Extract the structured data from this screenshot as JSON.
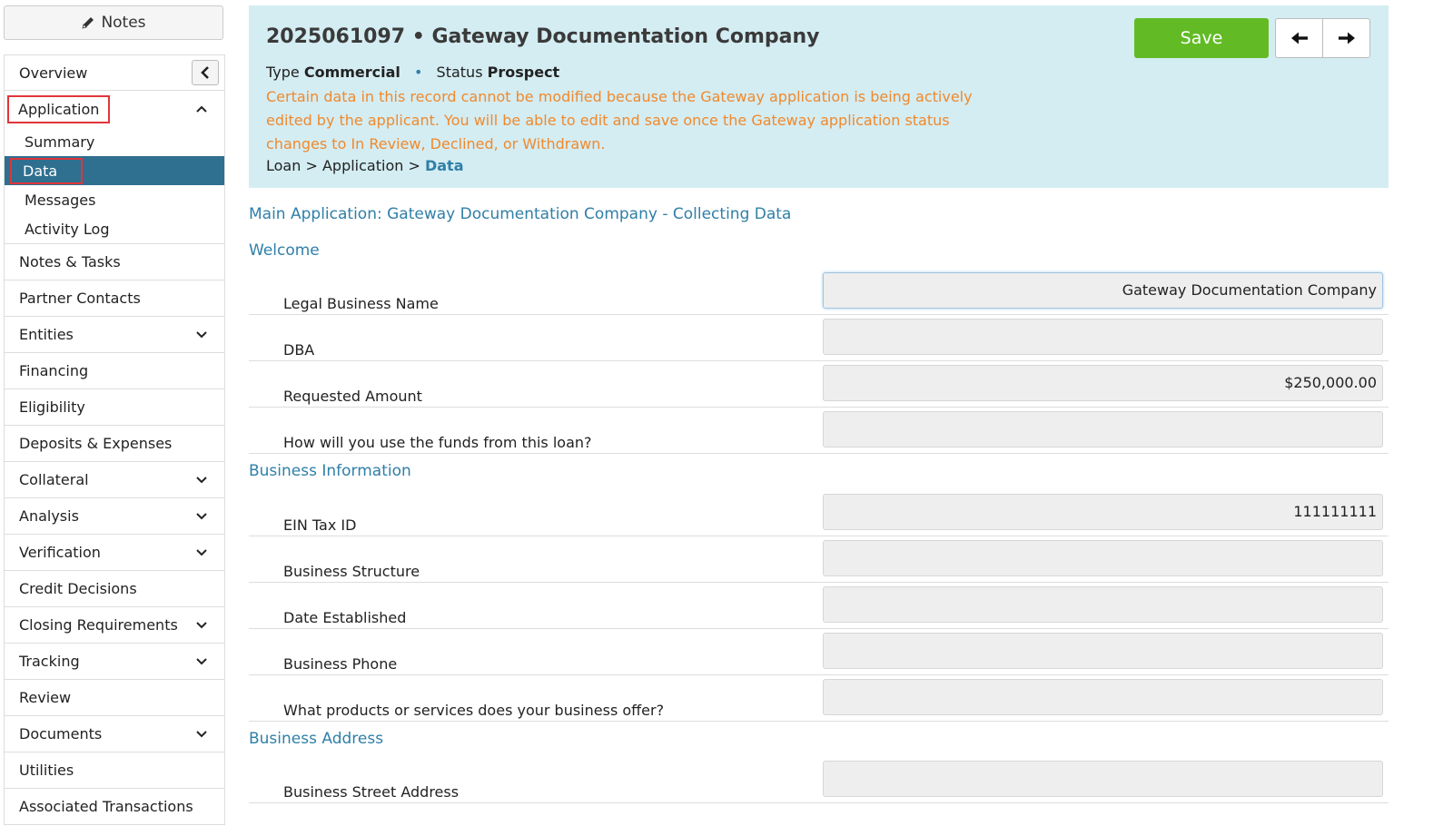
{
  "sidebar": {
    "notes_label": "Notes",
    "items": {
      "overview": "Overview",
      "application": "Application",
      "application_sub": [
        "Summary",
        "Data",
        "Messages",
        "Activity Log"
      ],
      "notes_tasks": "Notes & Tasks",
      "partner_contacts": "Partner Contacts",
      "entities": "Entities",
      "financing": "Financing",
      "eligibility": "Eligibility",
      "deposits_expenses": "Deposits & Expenses",
      "collateral": "Collateral",
      "analysis": "Analysis",
      "verification": "Verification",
      "credit_decisions": "Credit Decisions",
      "closing_requirements": "Closing Requirements",
      "tracking": "Tracking",
      "review": "Review",
      "documents": "Documents",
      "utilities": "Utilities",
      "associated_transactions": "Associated Transactions"
    }
  },
  "header": {
    "title": "2025061097 • Gateway Documentation Company",
    "type_label": "Type",
    "type_value": "Commercial",
    "status_label": "Status",
    "status_value": "Prospect",
    "warning": "Certain data in this record cannot be modified because the Gateway application is being actively edited by the applicant. You will be able to edit and save once the Gateway application status changes to In Review, Declined, or Withdrawn.",
    "breadcrumb": [
      "Loan",
      "Application",
      "Data"
    ],
    "save_label": "Save"
  },
  "form": {
    "main_title": "Main Application: Gateway Documentation Company - Collecting Data",
    "sections": {
      "welcome": "Welcome",
      "business_info": "Business Information",
      "business_address": "Business Address"
    },
    "fields": {
      "legal_name": {
        "label": "Legal Business Name",
        "value": "Gateway Documentation Company"
      },
      "dba": {
        "label": "DBA",
        "value": ""
      },
      "requested_amount": {
        "label": "Requested Amount",
        "value": "$250,000.00"
      },
      "use_of_funds": {
        "label": "How will you use the funds from this loan?",
        "value": ""
      },
      "ein": {
        "label": "EIN Tax ID",
        "value": "111111111"
      },
      "business_structure": {
        "label": "Business Structure",
        "value": ""
      },
      "date_established": {
        "label": "Date Established",
        "value": ""
      },
      "business_phone": {
        "label": "Business Phone",
        "value": ""
      },
      "products_services": {
        "label": "What products or services does your business offer?",
        "value": ""
      },
      "street_address": {
        "label": "Business Street Address",
        "value": ""
      }
    }
  },
  "colors": {
    "header_bg": "#d4edf3",
    "accent": "#2f7fa8",
    "save_green": "#62bb25",
    "warning_orange": "#f0892c",
    "active_nav": "#2f6f8f",
    "highlight_red": "#e0353a"
  }
}
